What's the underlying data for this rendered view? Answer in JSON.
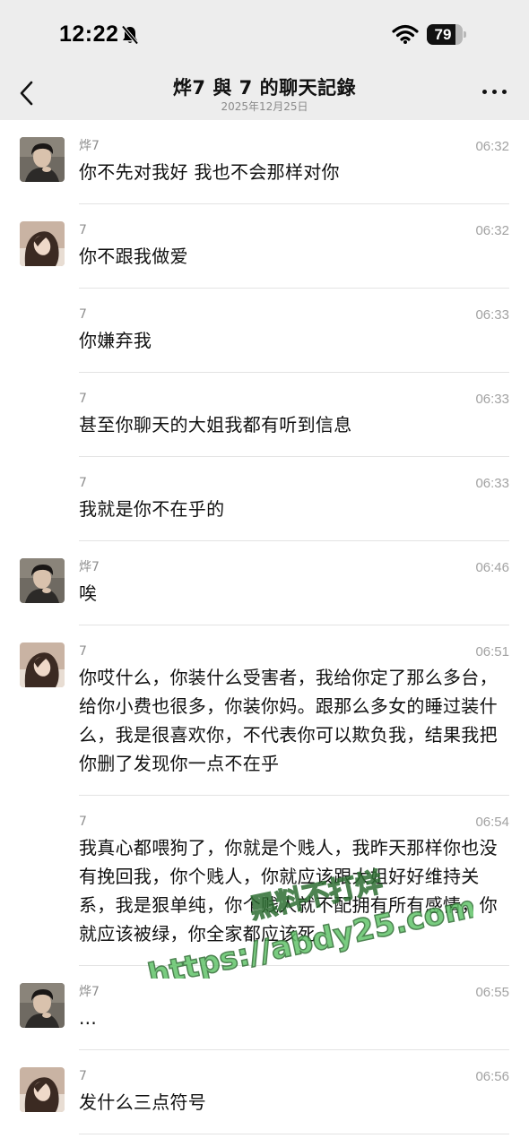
{
  "status_bar": {
    "time": "12:22",
    "battery": "79",
    "battery_level": 0.79,
    "icons": [
      "bell-muted-icon",
      "wifi-icon",
      "battery-icon"
    ]
  },
  "header": {
    "title": "烨7 與 7 的聊天記錄",
    "date": "2025年12月25日",
    "icons": [
      "back-chevron-icon",
      "more-dots-icon"
    ]
  },
  "messages": [
    {
      "sender": "烨7",
      "time": "06:32",
      "text": "你不先对我好 我也不会那样对你",
      "avatar": "male"
    },
    {
      "sender": "7",
      "time": "06:32",
      "text": "你不跟我做爱",
      "avatar": "female"
    },
    {
      "sender": "7",
      "time": "06:33",
      "text": "你嫌弃我",
      "avatar": ""
    },
    {
      "sender": "7",
      "time": "06:33",
      "text": "甚至你聊天的大姐我都有听到信息",
      "avatar": ""
    },
    {
      "sender": "7",
      "time": "06:33",
      "text": "我就是你不在乎的",
      "avatar": ""
    },
    {
      "sender": "烨7",
      "time": "06:46",
      "text": "唉",
      "avatar": "male"
    },
    {
      "sender": "7",
      "time": "06:51",
      "text": "你哎什么，你装什么受害者，我给你定了那么多台，给你小费也很多，你装你妈。跟那么多女的睡过装什么，我是很喜欢你，不代表你可以欺负我，结果我把你删了发现你一点不在乎",
      "avatar": "female"
    },
    {
      "sender": "7",
      "time": "06:54",
      "text": "我真心都喂狗了，你就是个贱人，我昨天那样你也没有挽回我，你个贱人，你就应该跟大姐好好维持关系，我是狠单纯，你个贱人就不配拥有所有感情，你就应该被绿，你全家都应该死",
      "avatar": ""
    },
    {
      "sender": "烨7",
      "time": "06:55",
      "text": "...",
      "avatar": "male"
    },
    {
      "sender": "7",
      "time": "06:56",
      "text": "发什么三点符号",
      "avatar": "female"
    }
  ],
  "watermark": {
    "line1": "黑料不打烊",
    "line2": "https://abdy25.com"
  }
}
